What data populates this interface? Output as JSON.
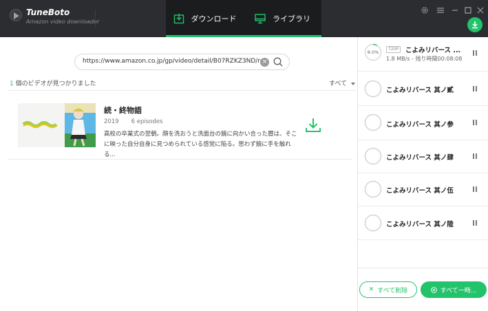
{
  "app": {
    "name": "TuneBoto",
    "subtitle": "Amazon video downloader",
    "tabs": [
      {
        "label": "ダウンロード",
        "icon": "download-box-icon",
        "active": true
      },
      {
        "label": "ライブラリ",
        "icon": "monitor-icon",
        "active": false
      }
    ],
    "accent_color": "#22c36b",
    "window_controls": [
      "gear-icon",
      "menu-icon",
      "minimize-icon",
      "maximize-icon",
      "close-icon"
    ]
  },
  "search": {
    "url_value": "https://www.amazon.co.jp/gp/video/detail/B07RZKZ3ND/ref=atv_3",
    "clear_glyph": "×"
  },
  "results": {
    "count": "1",
    "summary_suffix": " 個のビデオが見つかりました",
    "filter_label": "すべて"
  },
  "video": {
    "title": "続・終物語",
    "year": "2019",
    "episodes": "6 episodes",
    "description": "高校の卒業式の翌朝。顔を洗おうと洗面台の鏡に向かい合った暦は、そこに映った自分自身に見つめられている感覚に陥る。思わず鏡に手を触れる..."
  },
  "queue": {
    "items": [
      {
        "progress_text": "8.0%",
        "progress": 0.08,
        "quality": "720P",
        "title": "こよみリバース ...",
        "status": "1.8 MB/s - 残り時間00:08:08"
      },
      {
        "title": "こよみリバース 其ノ貳"
      },
      {
        "title": "こよみリバース 其ノ参"
      },
      {
        "title": "こよみリバース 其ノ肆"
      },
      {
        "title": "こよみリバース 其ノ伍"
      },
      {
        "title": "こよみリバース 其ノ陸"
      }
    ],
    "delete_all_label": "すべて削除",
    "pause_all_label": "すべて一時..."
  }
}
